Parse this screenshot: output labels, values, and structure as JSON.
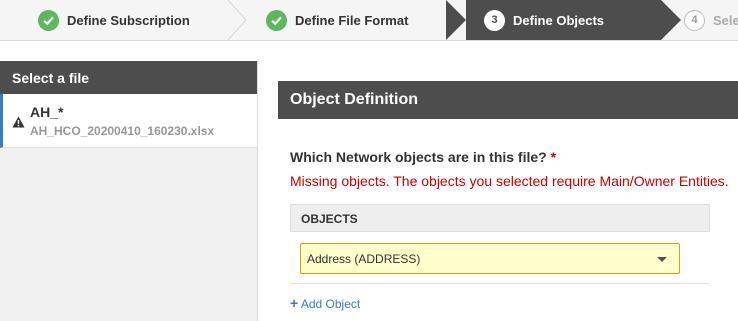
{
  "wizard": {
    "steps": [
      {
        "label": "Define Subscription",
        "state": "complete"
      },
      {
        "label": "Define File Format",
        "state": "complete"
      },
      {
        "number": "3",
        "label": "Define Objects",
        "state": "active"
      },
      {
        "number": "4",
        "label": "Sele",
        "state": "upcoming"
      }
    ]
  },
  "sidebar": {
    "title": "Select a file",
    "file": {
      "name": "AH_*",
      "filename": "AH_HCO_20200410_160230.xlsx",
      "icon": "warning-icon"
    }
  },
  "main": {
    "panel_title": "Object Definition",
    "question": "Which Network objects are in this file?",
    "required_mark": "*",
    "error": "Missing objects. The objects you selected require Main/Owner Entities.",
    "table_header": "OBJECTS",
    "selected_object": "Address (ADDRESS)",
    "add_symbol": "+",
    "add_label": "Add Object"
  },
  "colors": {
    "header_dark": "#4d4d4d",
    "success": "#5cb85c",
    "error": "#cc0000",
    "link": "#3a7bbf",
    "select_bg": "#ffffcc"
  }
}
